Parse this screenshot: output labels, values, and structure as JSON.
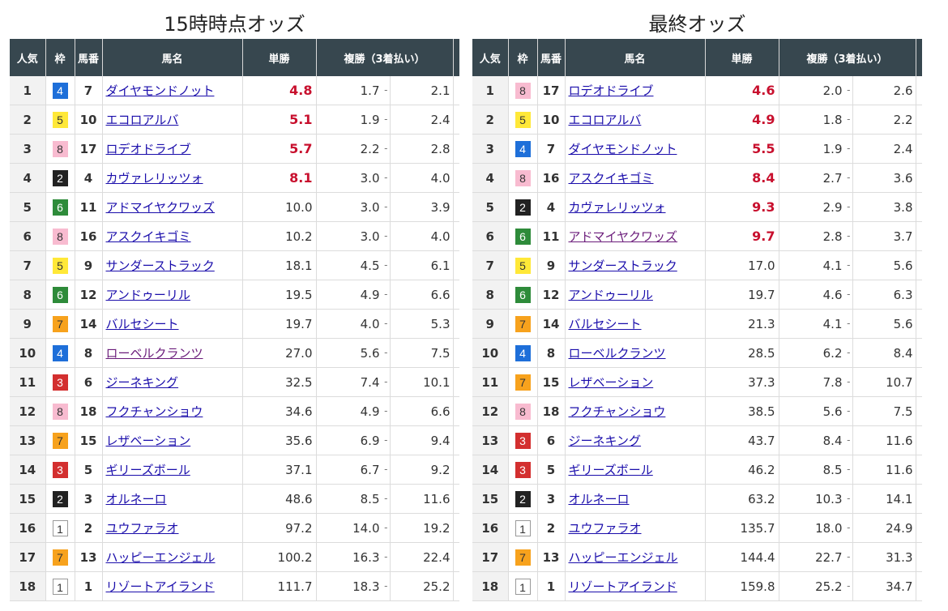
{
  "colors": {
    "header_bg": "#37474f",
    "win_hot": "#c8102e",
    "link": "#1a0dab"
  },
  "waku_colors": {
    "1": "#ffffff",
    "2": "#222222",
    "3": "#d32f2f",
    "4": "#1e6fd9",
    "5": "#ffe838",
    "6": "#2e8b3a",
    "7": "#f7a21d",
    "8": "#f8bbd0"
  },
  "headers": {
    "pop": "人気",
    "waku": "枠",
    "umaban": "馬番",
    "name": "馬名",
    "win": "単勝",
    "place": "複勝（3着払い）"
  },
  "tables": [
    {
      "title": "15時時点オッズ",
      "rows": [
        {
          "pop": "1",
          "waku": "4",
          "umaban": "7",
          "name": "ダイヤモンドノット",
          "win": "4.8",
          "hot": true,
          "plo": "1.7",
          "phi": "2.1"
        },
        {
          "pop": "2",
          "waku": "5",
          "umaban": "10",
          "name": "エコロアルバ",
          "win": "5.1",
          "hot": true,
          "plo": "1.9",
          "phi": "2.4"
        },
        {
          "pop": "3",
          "waku": "8",
          "umaban": "17",
          "name": "ロデオドライブ",
          "win": "5.7",
          "hot": true,
          "plo": "2.2",
          "phi": "2.8"
        },
        {
          "pop": "4",
          "waku": "2",
          "umaban": "4",
          "name": "カヴァレリッツォ",
          "win": "8.1",
          "hot": true,
          "plo": "3.0",
          "phi": "4.0"
        },
        {
          "pop": "5",
          "waku": "6",
          "umaban": "11",
          "name": "アドマイヤクワッズ",
          "win": "10.0",
          "hot": false,
          "plo": "3.0",
          "phi": "3.9"
        },
        {
          "pop": "6",
          "waku": "8",
          "umaban": "16",
          "name": "アスクイキゴミ",
          "win": "10.2",
          "hot": false,
          "plo": "3.0",
          "phi": "4.0"
        },
        {
          "pop": "7",
          "waku": "5",
          "umaban": "9",
          "name": "サンダーストラック",
          "win": "18.1",
          "hot": false,
          "plo": "4.5",
          "phi": "6.1"
        },
        {
          "pop": "8",
          "waku": "6",
          "umaban": "12",
          "name": "アンドゥーリル",
          "win": "19.5",
          "hot": false,
          "plo": "4.9",
          "phi": "6.6"
        },
        {
          "pop": "9",
          "waku": "7",
          "umaban": "14",
          "name": "バルセシート",
          "win": "19.7",
          "hot": false,
          "plo": "4.0",
          "phi": "5.3"
        },
        {
          "pop": "10",
          "waku": "4",
          "umaban": "8",
          "name": "ローベルクランツ",
          "win": "27.0",
          "hot": false,
          "plo": "5.6",
          "phi": "7.5",
          "visited": true
        },
        {
          "pop": "11",
          "waku": "3",
          "umaban": "6",
          "name": "ジーネキング",
          "win": "32.5",
          "hot": false,
          "plo": "7.4",
          "phi": "10.1"
        },
        {
          "pop": "12",
          "waku": "8",
          "umaban": "18",
          "name": "フクチャンショウ",
          "win": "34.6",
          "hot": false,
          "plo": "4.9",
          "phi": "6.6"
        },
        {
          "pop": "13",
          "waku": "7",
          "umaban": "15",
          "name": "レザベーション",
          "win": "35.6",
          "hot": false,
          "plo": "6.9",
          "phi": "9.4"
        },
        {
          "pop": "14",
          "waku": "3",
          "umaban": "5",
          "name": "ギリーズボール",
          "win": "37.1",
          "hot": false,
          "plo": "6.7",
          "phi": "9.2"
        },
        {
          "pop": "15",
          "waku": "2",
          "umaban": "3",
          "name": "オルネーロ",
          "win": "48.6",
          "hot": false,
          "plo": "8.5",
          "phi": "11.6"
        },
        {
          "pop": "16",
          "waku": "1",
          "umaban": "2",
          "name": "ユウファラオ",
          "win": "97.2",
          "hot": false,
          "plo": "14.0",
          "phi": "19.2"
        },
        {
          "pop": "17",
          "waku": "7",
          "umaban": "13",
          "name": "ハッピーエンジェル",
          "win": "100.2",
          "hot": false,
          "plo": "16.3",
          "phi": "22.4"
        },
        {
          "pop": "18",
          "waku": "1",
          "umaban": "1",
          "name": "リゾートアイランド",
          "win": "111.7",
          "hot": false,
          "plo": "18.3",
          "phi": "25.2"
        }
      ]
    },
    {
      "title": "最終オッズ",
      "rows": [
        {
          "pop": "1",
          "waku": "8",
          "umaban": "17",
          "name": "ロデオドライブ",
          "win": "4.6",
          "hot": true,
          "plo": "2.0",
          "phi": "2.6"
        },
        {
          "pop": "2",
          "waku": "5",
          "umaban": "10",
          "name": "エコロアルバ",
          "win": "4.9",
          "hot": true,
          "plo": "1.8",
          "phi": "2.2"
        },
        {
          "pop": "3",
          "waku": "4",
          "umaban": "7",
          "name": "ダイヤモンドノット",
          "win": "5.5",
          "hot": true,
          "plo": "1.9",
          "phi": "2.4"
        },
        {
          "pop": "4",
          "waku": "8",
          "umaban": "16",
          "name": "アスクイキゴミ",
          "win": "8.4",
          "hot": true,
          "plo": "2.7",
          "phi": "3.6"
        },
        {
          "pop": "5",
          "waku": "2",
          "umaban": "4",
          "name": "カヴァレリッツォ",
          "win": "9.3",
          "hot": true,
          "plo": "2.9",
          "phi": "3.8"
        },
        {
          "pop": "6",
          "waku": "6",
          "umaban": "11",
          "name": "アドマイヤクワッズ",
          "win": "9.7",
          "hot": true,
          "plo": "2.8",
          "phi": "3.7",
          "visited": true
        },
        {
          "pop": "7",
          "waku": "5",
          "umaban": "9",
          "name": "サンダーストラック",
          "win": "17.0",
          "hot": false,
          "plo": "4.1",
          "phi": "5.6"
        },
        {
          "pop": "8",
          "waku": "6",
          "umaban": "12",
          "name": "アンドゥーリル",
          "win": "19.7",
          "hot": false,
          "plo": "4.6",
          "phi": "6.3"
        },
        {
          "pop": "9",
          "waku": "7",
          "umaban": "14",
          "name": "バルセシート",
          "win": "21.3",
          "hot": false,
          "plo": "4.1",
          "phi": "5.6"
        },
        {
          "pop": "10",
          "waku": "4",
          "umaban": "8",
          "name": "ローベルクランツ",
          "win": "28.5",
          "hot": false,
          "plo": "6.2",
          "phi": "8.4"
        },
        {
          "pop": "11",
          "waku": "7",
          "umaban": "15",
          "name": "レザベーション",
          "win": "37.3",
          "hot": false,
          "plo": "7.8",
          "phi": "10.7"
        },
        {
          "pop": "12",
          "waku": "8",
          "umaban": "18",
          "name": "フクチャンショウ",
          "win": "38.5",
          "hot": false,
          "plo": "5.6",
          "phi": "7.5"
        },
        {
          "pop": "13",
          "waku": "3",
          "umaban": "6",
          "name": "ジーネキング",
          "win": "43.7",
          "hot": false,
          "plo": "8.4",
          "phi": "11.6"
        },
        {
          "pop": "14",
          "waku": "3",
          "umaban": "5",
          "name": "ギリーズボール",
          "win": "46.2",
          "hot": false,
          "plo": "8.5",
          "phi": "11.6"
        },
        {
          "pop": "15",
          "waku": "2",
          "umaban": "3",
          "name": "オルネーロ",
          "win": "63.2",
          "hot": false,
          "plo": "10.3",
          "phi": "14.1"
        },
        {
          "pop": "16",
          "waku": "1",
          "umaban": "2",
          "name": "ユウファラオ",
          "win": "135.7",
          "hot": false,
          "plo": "18.0",
          "phi": "24.9"
        },
        {
          "pop": "17",
          "waku": "7",
          "umaban": "13",
          "name": "ハッピーエンジェル",
          "win": "144.4",
          "hot": false,
          "plo": "22.7",
          "phi": "31.3"
        },
        {
          "pop": "18",
          "waku": "1",
          "umaban": "1",
          "name": "リゾートアイランド",
          "win": "159.8",
          "hot": false,
          "plo": "25.2",
          "phi": "34.7"
        }
      ]
    }
  ]
}
